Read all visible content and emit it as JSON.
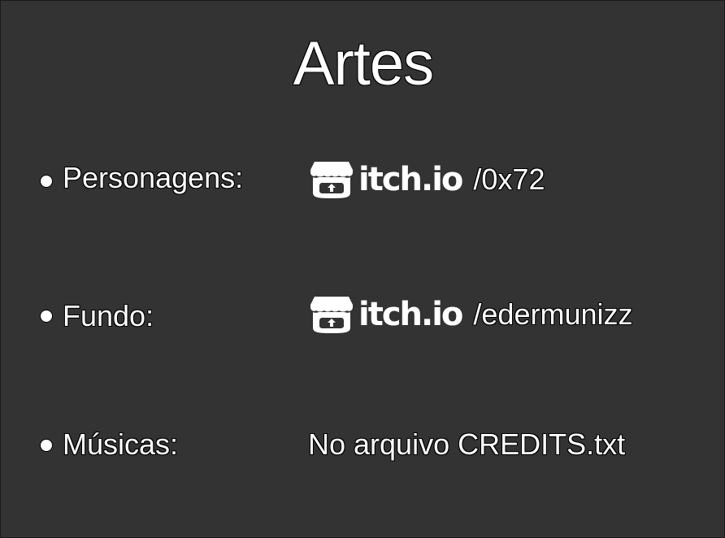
{
  "slide": {
    "title": "Artes",
    "items": [
      {
        "label": "Personagens:",
        "logo_text": "itch.io",
        "value": "/0x72"
      },
      {
        "label": "Fundo:",
        "logo_text": "itch.io",
        "value": "/edermunizz"
      },
      {
        "label": "Músicas:",
        "value": "No arquivo CREDITS.txt"
      }
    ]
  },
  "icons": {
    "logo": "itch-io-store-icon"
  },
  "colors": {
    "background": "#333333",
    "text": "#ffffff",
    "outline": "#000000"
  }
}
